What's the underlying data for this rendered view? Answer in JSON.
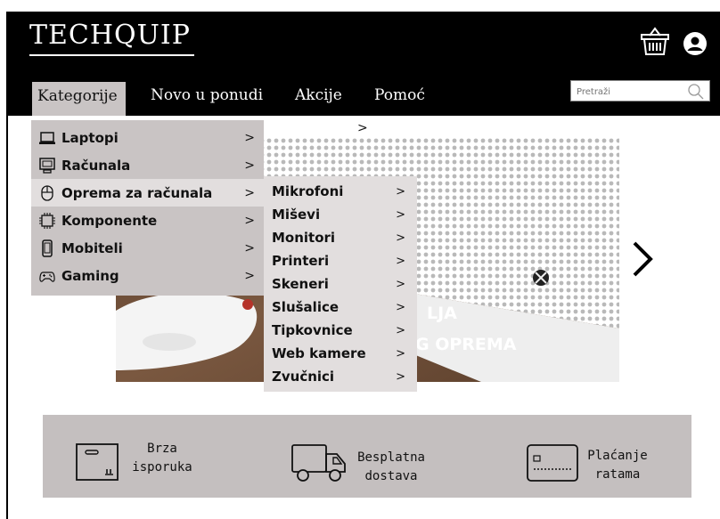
{
  "brand": {
    "logo": "TECHQUIP"
  },
  "nav": {
    "items": [
      {
        "label": "Kategorije"
      },
      {
        "label": "Novo u ponudi"
      },
      {
        "label": "Akcije"
      },
      {
        "label": "Pomoć"
      }
    ]
  },
  "search": {
    "placeholder": "Pretraži",
    "icon": "search-icon"
  },
  "header_icons": {
    "cart": "basket-icon",
    "user": "user-icon"
  },
  "categories": [
    {
      "label": "Laptopi",
      "icon": "laptop-icon",
      "chevron": ">"
    },
    {
      "label": "Računala",
      "icon": "desktop-icon",
      "chevron": ">"
    },
    {
      "label": "Oprema za računala",
      "icon": "mouse-icon",
      "chevron": ">",
      "active": true
    },
    {
      "label": "Komponente",
      "icon": "chip-icon",
      "chevron": ">"
    },
    {
      "label": "Mobiteli",
      "icon": "phone-icon",
      "chevron": ">"
    },
    {
      "label": "Gaming",
      "icon": "gamepad-icon",
      "chevron": ">"
    }
  ],
  "subcategories": [
    {
      "label": "Mikrofoni",
      "chevron": ">"
    },
    {
      "label": "Miševi",
      "chevron": ">"
    },
    {
      "label": "Monitori",
      "chevron": ">"
    },
    {
      "label": "Printeri",
      "chevron": ">"
    },
    {
      "label": "Skeneri",
      "chevron": ">"
    },
    {
      "label": "Slušalice",
      "chevron": ">"
    },
    {
      "label": "Tipkovnice",
      "chevron": ">"
    },
    {
      "label": "Web kamere",
      "chevron": ">"
    },
    {
      "label": "Zvučnici",
      "chevron": ">"
    }
  ],
  "banner": {
    "text_line1": "LJA",
    "text_line2": "G OPREMA",
    "top_arrow": ">",
    "next_arrow": "chevron-right-icon"
  },
  "features": [
    {
      "line1": "Brza",
      "line2": "isporuka",
      "icon": "box-icon"
    },
    {
      "line1": "Besplatna",
      "line2": "dostava",
      "icon": "truck-icon"
    },
    {
      "line1": "Plaćanje",
      "line2": "ratama",
      "icon": "credit-card-icon"
    }
  ],
  "colors": {
    "header_bg": "#000000",
    "menu_bg": "#c9c4c4",
    "submenu_bg": "#e2dede",
    "features_bg": "#c4bfbf"
  }
}
